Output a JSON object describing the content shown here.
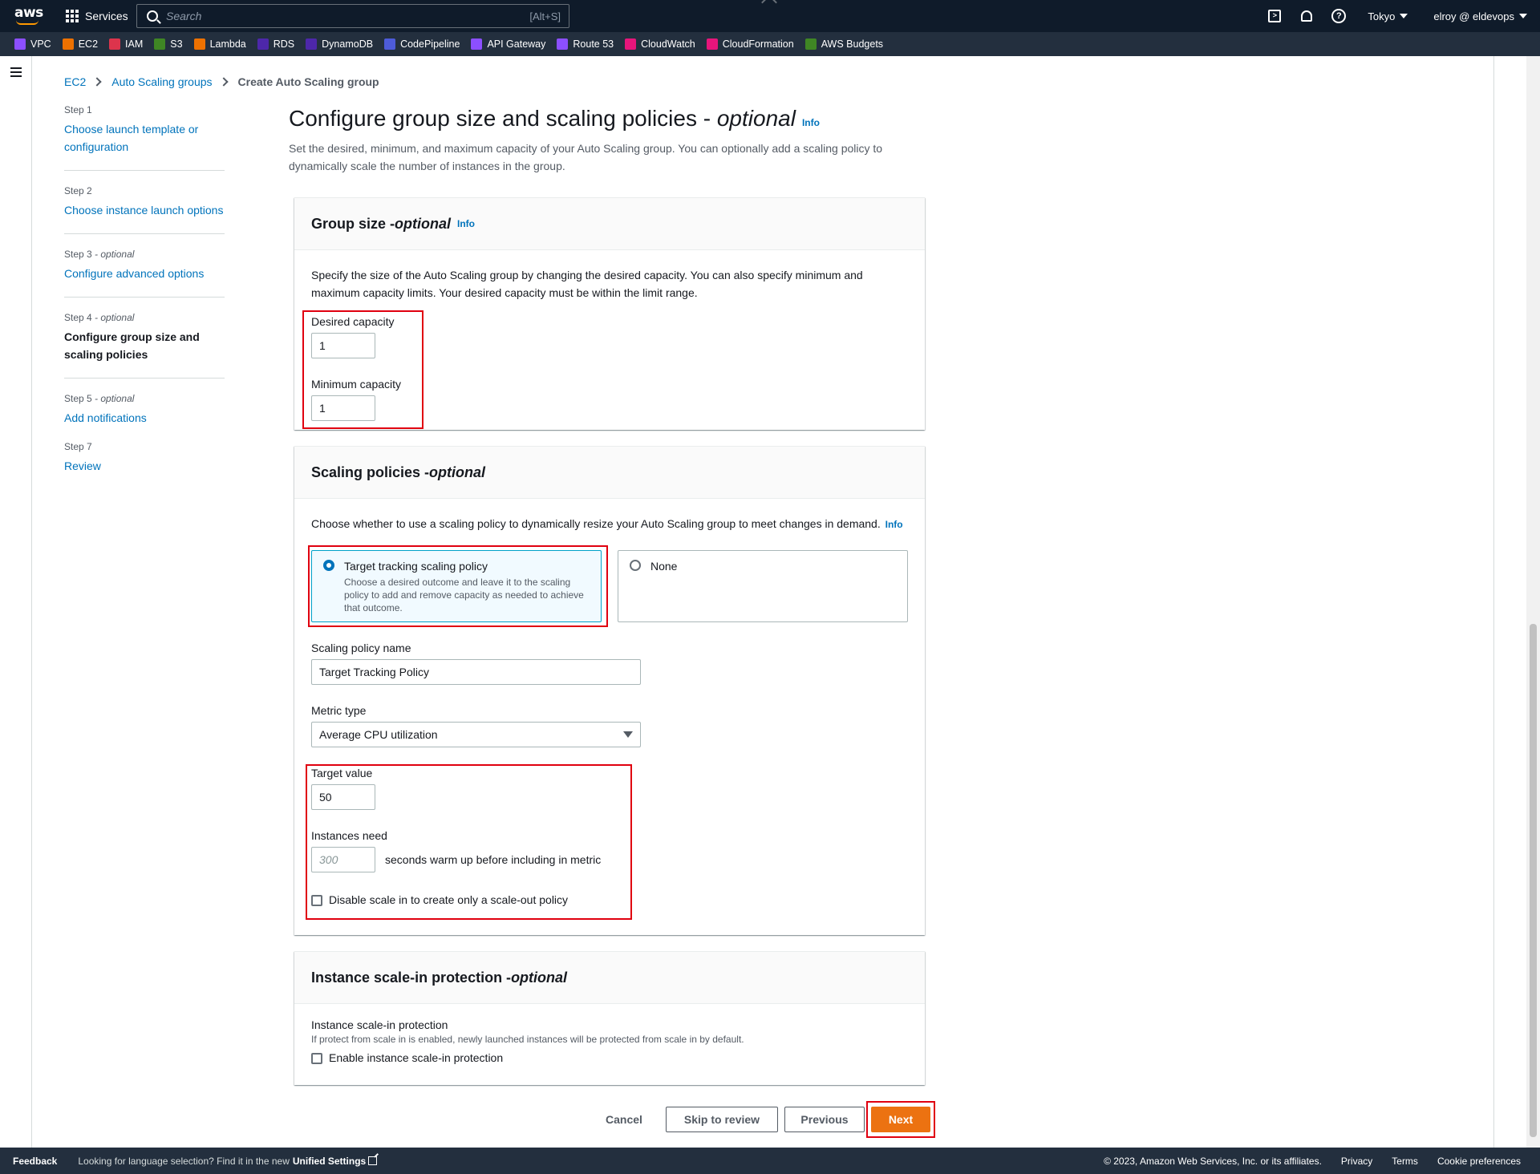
{
  "topnav": {
    "logo": "aws",
    "services_label": "Services",
    "search_placeholder": "Search",
    "search_shortcut": "[Alt+S]",
    "region": "Tokyo",
    "account": "elroy @ eldevops"
  },
  "favorites": [
    {
      "label": "VPC",
      "color": "#8c4fff"
    },
    {
      "label": "EC2",
      "color": "#ed7100"
    },
    {
      "label": "IAM",
      "color": "#dd344c"
    },
    {
      "label": "S3",
      "color": "#3f8624"
    },
    {
      "label": "Lambda",
      "color": "#ed7100"
    },
    {
      "label": "RDS",
      "color": "#4d27aa"
    },
    {
      "label": "DynamoDB",
      "color": "#4d27aa"
    },
    {
      "label": "CodePipeline",
      "color": "#4d5bd9"
    },
    {
      "label": "API Gateway",
      "color": "#8c4fff"
    },
    {
      "label": "Route 53",
      "color": "#8c4fff"
    },
    {
      "label": "CloudWatch",
      "color": "#e7157b"
    },
    {
      "label": "CloudFormation",
      "color": "#e7157b"
    },
    {
      "label": "AWS Budgets",
      "color": "#3f8624"
    }
  ],
  "breadcrumb": {
    "ec2": "EC2",
    "asg": "Auto Scaling groups",
    "current": "Create Auto Scaling group"
  },
  "steps": [
    {
      "num": "Step 1",
      "opt": "",
      "label_1": "Choose launch template or",
      "label_2": "configuration"
    },
    {
      "num": "Step 2",
      "opt": "",
      "label_1": "Choose instance launch options",
      "label_2": ""
    },
    {
      "num": "Step 3",
      "opt": " - optional",
      "label_1": "Configure advanced options",
      "label_2": ""
    },
    {
      "num": "Step 4",
      "opt": " - optional",
      "label_1": "Configure group size and",
      "label_2": "scaling policies"
    },
    {
      "num": "Step 5",
      "opt": " - optional",
      "label_1": "Add notifications",
      "label_2": ""
    },
    {
      "num": "Step 7",
      "opt": "",
      "label_1": "Review",
      "label_2": ""
    }
  ],
  "page": {
    "title": "Configure group size and scaling policies - ",
    "title_opt": "optional",
    "info": "Info",
    "desc": "Set the desired, minimum, and maximum capacity of your Auto Scaling group. You can optionally add a scaling policy to dynamically scale the number of instances in the group."
  },
  "group_size": {
    "title": "Group size - ",
    "title_opt": "optional",
    "info": "Info",
    "desc": "Specify the size of the Auto Scaling group by changing the desired capacity. You can also specify minimum and maximum capacity limits. Your desired capacity must be within the limit range.",
    "desired_label": "Desired capacity",
    "desired_value": "1",
    "min_label": "Minimum capacity",
    "min_value": "1"
  },
  "scaling": {
    "title": "Scaling policies - ",
    "title_opt": "optional",
    "desc": "Choose whether to use a scaling policy to dynamically resize your Auto Scaling group to meet changes in demand.",
    "info": "Info",
    "option_target": "Target tracking scaling policy",
    "option_target_desc": "Choose a desired outcome and leave it to the scaling policy to add and remove capacity as needed to achieve that outcome.",
    "option_none": "None",
    "policy_name_label": "Scaling policy name",
    "policy_name_value": "Target Tracking Policy",
    "metric_label": "Metric type",
    "metric_value": "Average CPU utilization",
    "target_label": "Target value",
    "target_value": "50",
    "warmup_label": "Instances need",
    "warmup_placeholder": "300",
    "warmup_suffix": "seconds warm up before including in metric",
    "disable_scale_in": "Disable scale in to create only a scale-out policy"
  },
  "protection": {
    "title": "Instance scale-in protection - ",
    "title_opt": "optional",
    "label": "Instance scale-in protection",
    "desc": "If protect from scale in is enabled, newly launched instances will be protected from scale in by default.",
    "checkbox": "Enable instance scale-in protection"
  },
  "actions": {
    "cancel": "Cancel",
    "skip": "Skip to review",
    "previous": "Previous",
    "next": "Next"
  },
  "footer": {
    "feedback": "Feedback",
    "lang_text": "Looking for language selection? Find it in the new",
    "unified": "Unified Settings",
    "copyright": "© 2023, Amazon Web Services, Inc. or its affiliates.",
    "privacy": "Privacy",
    "terms": "Terms",
    "cookies": "Cookie preferences"
  }
}
